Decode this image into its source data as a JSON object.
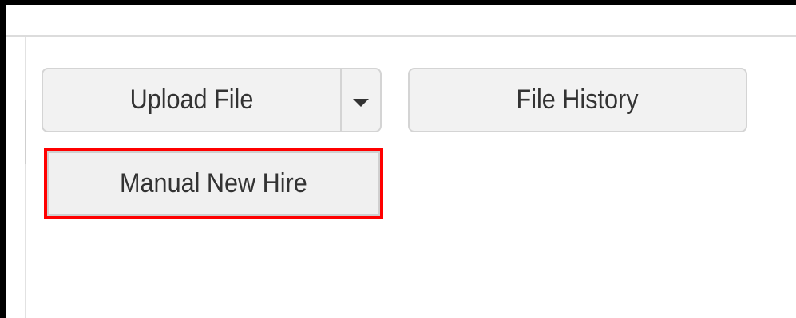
{
  "toolbar": {
    "upload_file_label": "Upload File",
    "upload_dropdown_icon": "chevron-down-icon",
    "file_history_label": "File History",
    "manual_new_hire_label": "Manual New Hire"
  },
  "annotation": {
    "highlight_color": "#ff0000",
    "highlight_target": "Manual New Hire"
  },
  "colors": {
    "button_bg": "#f2f2f2",
    "button_border": "#d4d4d4",
    "text": "#333333",
    "frame": "#000000"
  }
}
